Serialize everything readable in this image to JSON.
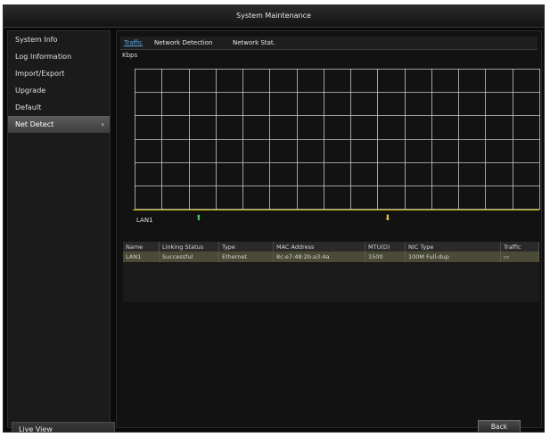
{
  "window": {
    "title": "System Maintenance"
  },
  "sidebar": {
    "items": [
      {
        "label": "System Info"
      },
      {
        "label": "Log Information"
      },
      {
        "label": "Import/Export"
      },
      {
        "label": "Upgrade"
      },
      {
        "label": "Default"
      },
      {
        "label": "Net Detect",
        "chevron": "›"
      }
    ],
    "live_view_label": "Live View"
  },
  "tabs": [
    {
      "label": "Traffic"
    },
    {
      "label": "Network Detection"
    },
    {
      "label": "Network Stat."
    }
  ],
  "graph": {
    "unit_label": "Kbps",
    "lan_label": "LAN1",
    "up_arrow": "⬆",
    "down_arrow": "⬇",
    "colors": {
      "grid": "#c8c8c8",
      "baseline": "#c8b400",
      "up": "#49c468",
      "down": "#e6c93c"
    }
  },
  "nic_table": {
    "headers": [
      "Name",
      "Linking Status",
      "Type",
      "MAC Address",
      "MTU(D)",
      "NIC Type",
      "Traffic"
    ],
    "rows": [
      [
        "LAN1",
        "Successful",
        "Ethernet",
        "8c:e7:48:2b:a3:4a",
        "1500",
        "100M Full-dup",
        "▭"
      ]
    ]
  },
  "footer": {
    "back_label": "Back"
  }
}
